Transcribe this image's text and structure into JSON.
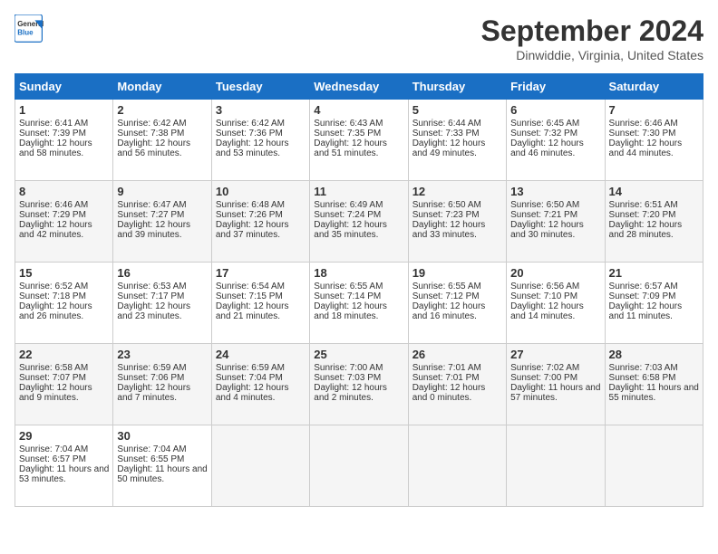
{
  "logo": {
    "line1": "General",
    "line2": "Blue"
  },
  "title": "September 2024",
  "subtitle": "Dinwiddie, Virginia, United States",
  "days_of_week": [
    "Sunday",
    "Monday",
    "Tuesday",
    "Wednesday",
    "Thursday",
    "Friday",
    "Saturday"
  ],
  "weeks": [
    [
      {
        "day": "1",
        "sunrise": "6:41 AM",
        "sunset": "7:39 PM",
        "daylight": "12 hours and 58 minutes."
      },
      {
        "day": "2",
        "sunrise": "6:42 AM",
        "sunset": "7:38 PM",
        "daylight": "12 hours and 56 minutes."
      },
      {
        "day": "3",
        "sunrise": "6:42 AM",
        "sunset": "7:36 PM",
        "daylight": "12 hours and 53 minutes."
      },
      {
        "day": "4",
        "sunrise": "6:43 AM",
        "sunset": "7:35 PM",
        "daylight": "12 hours and 51 minutes."
      },
      {
        "day": "5",
        "sunrise": "6:44 AM",
        "sunset": "7:33 PM",
        "daylight": "12 hours and 49 minutes."
      },
      {
        "day": "6",
        "sunrise": "6:45 AM",
        "sunset": "7:32 PM",
        "daylight": "12 hours and 46 minutes."
      },
      {
        "day": "7",
        "sunrise": "6:46 AM",
        "sunset": "7:30 PM",
        "daylight": "12 hours and 44 minutes."
      }
    ],
    [
      {
        "day": "8",
        "sunrise": "6:46 AM",
        "sunset": "7:29 PM",
        "daylight": "12 hours and 42 minutes."
      },
      {
        "day": "9",
        "sunrise": "6:47 AM",
        "sunset": "7:27 PM",
        "daylight": "12 hours and 39 minutes."
      },
      {
        "day": "10",
        "sunrise": "6:48 AM",
        "sunset": "7:26 PM",
        "daylight": "12 hours and 37 minutes."
      },
      {
        "day": "11",
        "sunrise": "6:49 AM",
        "sunset": "7:24 PM",
        "daylight": "12 hours and 35 minutes."
      },
      {
        "day": "12",
        "sunrise": "6:50 AM",
        "sunset": "7:23 PM",
        "daylight": "12 hours and 33 minutes."
      },
      {
        "day": "13",
        "sunrise": "6:50 AM",
        "sunset": "7:21 PM",
        "daylight": "12 hours and 30 minutes."
      },
      {
        "day": "14",
        "sunrise": "6:51 AM",
        "sunset": "7:20 PM",
        "daylight": "12 hours and 28 minutes."
      }
    ],
    [
      {
        "day": "15",
        "sunrise": "6:52 AM",
        "sunset": "7:18 PM",
        "daylight": "12 hours and 26 minutes."
      },
      {
        "day": "16",
        "sunrise": "6:53 AM",
        "sunset": "7:17 PM",
        "daylight": "12 hours and 23 minutes."
      },
      {
        "day": "17",
        "sunrise": "6:54 AM",
        "sunset": "7:15 PM",
        "daylight": "12 hours and 21 minutes."
      },
      {
        "day": "18",
        "sunrise": "6:55 AM",
        "sunset": "7:14 PM",
        "daylight": "12 hours and 18 minutes."
      },
      {
        "day": "19",
        "sunrise": "6:55 AM",
        "sunset": "7:12 PM",
        "daylight": "12 hours and 16 minutes."
      },
      {
        "day": "20",
        "sunrise": "6:56 AM",
        "sunset": "7:10 PM",
        "daylight": "12 hours and 14 minutes."
      },
      {
        "day": "21",
        "sunrise": "6:57 AM",
        "sunset": "7:09 PM",
        "daylight": "12 hours and 11 minutes."
      }
    ],
    [
      {
        "day": "22",
        "sunrise": "6:58 AM",
        "sunset": "7:07 PM",
        "daylight": "12 hours and 9 minutes."
      },
      {
        "day": "23",
        "sunrise": "6:59 AM",
        "sunset": "7:06 PM",
        "daylight": "12 hours and 7 minutes."
      },
      {
        "day": "24",
        "sunrise": "6:59 AM",
        "sunset": "7:04 PM",
        "daylight": "12 hours and 4 minutes."
      },
      {
        "day": "25",
        "sunrise": "7:00 AM",
        "sunset": "7:03 PM",
        "daylight": "12 hours and 2 minutes."
      },
      {
        "day": "26",
        "sunrise": "7:01 AM",
        "sunset": "7:01 PM",
        "daylight": "12 hours and 0 minutes."
      },
      {
        "day": "27",
        "sunrise": "7:02 AM",
        "sunset": "7:00 PM",
        "daylight": "11 hours and 57 minutes."
      },
      {
        "day": "28",
        "sunrise": "7:03 AM",
        "sunset": "6:58 PM",
        "daylight": "11 hours and 55 minutes."
      }
    ],
    [
      {
        "day": "29",
        "sunrise": "7:04 AM",
        "sunset": "6:57 PM",
        "daylight": "11 hours and 53 minutes."
      },
      {
        "day": "30",
        "sunrise": "7:04 AM",
        "sunset": "6:55 PM",
        "daylight": "11 hours and 50 minutes."
      },
      null,
      null,
      null,
      null,
      null
    ]
  ],
  "labels": {
    "sunrise": "Sunrise:",
    "sunset": "Sunset:",
    "daylight": "Daylight:"
  }
}
